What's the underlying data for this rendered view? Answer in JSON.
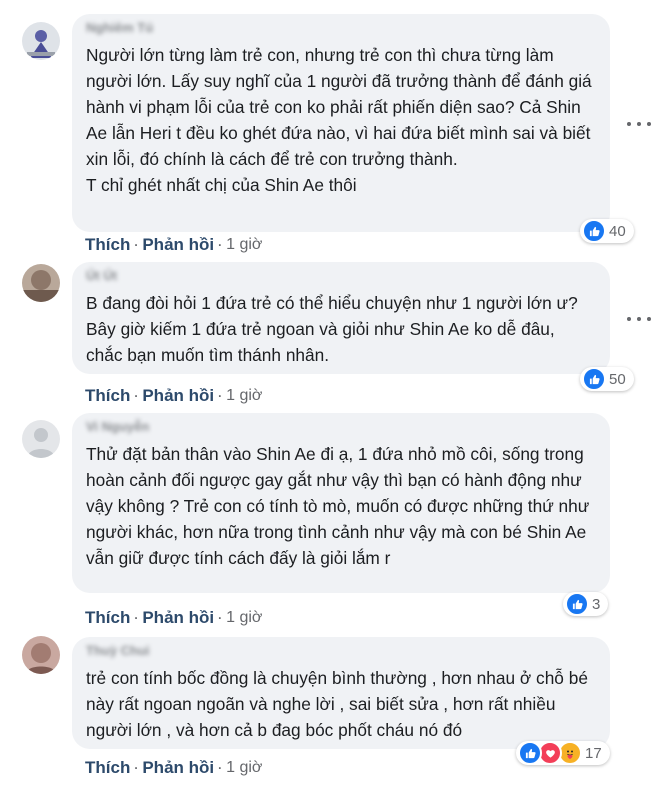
{
  "comments": [
    {
      "author": "Nghiêm Tú",
      "text": "Người lớn từng làm trẻ con, nhưng trẻ con thì chưa từng làm người lớn. Lấy suy nghĩ của 1 người đã trưởng thành để đánh giá hành vi phạm lỗi của trẻ con ko phải rất phiến diện sao? Cả Shin Ae lẫn Heri t đều ko ghét đứa nào, vì hai đứa biết mình sai và biết xin lỗi, đó chính là cách để trẻ con trưởng thành.\nT chỉ ghét nhất chị của Shin Ae thôi",
      "reaction_count": "40",
      "reactions": [
        "like-icon"
      ],
      "like_label": "Thích",
      "reply_label": "Phản hồi",
      "time": "1 giờ"
    },
    {
      "author": "Út Út",
      "text": "B đang đòi hỏi 1 đứa trẻ có thể hiểu chuyện như 1 người lớn ư? Bây giờ kiếm 1 đứa trẻ ngoan và giỏi như Shin Ae ko dễ đâu, chắc bạn muốn tìm thánh nhân.",
      "reaction_count": "50",
      "reactions": [
        "like-icon"
      ],
      "like_label": "Thích",
      "reply_label": "Phản hồi",
      "time": "1 giờ"
    },
    {
      "author": "Vi Nguyễn",
      "text": "Thử đặt bản thân vào Shin Ae đi ạ, 1 đứa nhỏ mồ côi, sống trong hoàn cảnh đối ngược gay gắt như vậy thì bạn có hành động như vậy không ? Trẻ con có tính tò mò, muốn có được những thứ như người khác, hơn nữa trong tình cảnh như vậy mà con bé Shin Ae vẫn giữ được tính cách đấy là giỏi lắm r",
      "reaction_count": "3",
      "reactions": [
        "like-icon"
      ],
      "like_label": "Thích",
      "reply_label": "Phản hồi",
      "time": "1 giờ"
    },
    {
      "author": "Thuỳ Chui",
      "text": "trẻ con tính bốc đồng là chuyện bình thường , hơn nhau ở chỗ bé này rất ngoan ngoãn và nghe lời , sai biết sửa , hơn rất nhiều người lớn , và hơn cả b đag bóc phốt cháu nó đó",
      "reaction_count": "17",
      "reactions": [
        "like-icon",
        "love-icon",
        "care-icon"
      ],
      "like_label": "Thích",
      "reply_label": "Phản hồi",
      "time": "1 giờ"
    }
  ],
  "colors": {
    "like": "#1877f2",
    "love": "#f33e58",
    "care": "#f7b125",
    "bubble": "#f0f2f5",
    "action": "#2d4a6b"
  }
}
